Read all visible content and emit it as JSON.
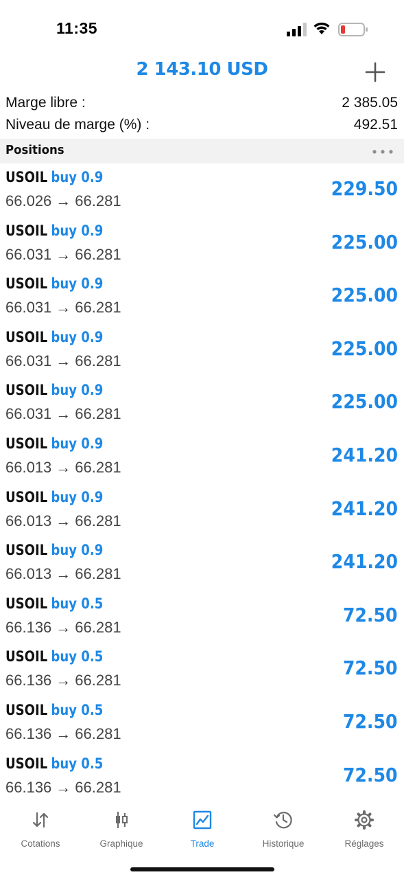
{
  "status_bar": {
    "time": "11:35",
    "battery_color": "#e53935"
  },
  "header": {
    "balance": "2 143.10 USD",
    "add_icon": "plus-icon"
  },
  "summary": {
    "free_margin_label": "Marge libre :",
    "free_margin_value": "2 385.05",
    "margin_level_label": "Niveau de marge (%) :",
    "margin_level_value": "492.51"
  },
  "positions": {
    "title": "Positions",
    "more_icon": "more-horizontal-icon",
    "items": [
      {
        "symbol": "USOIL",
        "side": "buy 0.9",
        "open": "66.026",
        "arrow": "→",
        "current": "66.281",
        "profit": "229.50"
      },
      {
        "symbol": "USOIL",
        "side": "buy 0.9",
        "open": "66.031",
        "arrow": "→",
        "current": "66.281",
        "profit": "225.00"
      },
      {
        "symbol": "USOIL",
        "side": "buy 0.9",
        "open": "66.031",
        "arrow": "→",
        "current": "66.281",
        "profit": "225.00"
      },
      {
        "symbol": "USOIL",
        "side": "buy 0.9",
        "open": "66.031",
        "arrow": "→",
        "current": "66.281",
        "profit": "225.00"
      },
      {
        "symbol": "USOIL",
        "side": "buy 0.9",
        "open": "66.031",
        "arrow": "→",
        "current": "66.281",
        "profit": "225.00"
      },
      {
        "symbol": "USOIL",
        "side": "buy 0.9",
        "open": "66.013",
        "arrow": "→",
        "current": "66.281",
        "profit": "241.20"
      },
      {
        "symbol": "USOIL",
        "side": "buy 0.9",
        "open": "66.013",
        "arrow": "→",
        "current": "66.281",
        "profit": "241.20"
      },
      {
        "symbol": "USOIL",
        "side": "buy 0.9",
        "open": "66.013",
        "arrow": "→",
        "current": "66.281",
        "profit": "241.20"
      },
      {
        "symbol": "USOIL",
        "side": "buy 0.5",
        "open": "66.136",
        "arrow": "→",
        "current": "66.281",
        "profit": "72.50"
      },
      {
        "symbol": "USOIL",
        "side": "buy 0.5",
        "open": "66.136",
        "arrow": "→",
        "current": "66.281",
        "profit": "72.50"
      },
      {
        "symbol": "USOIL",
        "side": "buy 0.5",
        "open": "66.136",
        "arrow": "→",
        "current": "66.281",
        "profit": "72.50"
      },
      {
        "symbol": "USOIL",
        "side": "buy 0.5",
        "open": "66.136",
        "arrow": "→",
        "current": "66.281",
        "profit": "72.50"
      }
    ]
  },
  "tabs": [
    {
      "label": "Cotations",
      "icon": "quotes-arrows-icon",
      "active": false
    },
    {
      "label": "Graphique",
      "icon": "candlestick-chart-icon",
      "active": false
    },
    {
      "label": "Trade",
      "icon": "trade-chart-icon",
      "active": true
    },
    {
      "label": "Historique",
      "icon": "history-clock-icon",
      "active": false
    },
    {
      "label": "Réglages",
      "icon": "gear-icon",
      "active": false
    }
  ],
  "colors": {
    "accent": "#1e88e5",
    "section_bg": "#f2f2f2",
    "inactive_tab": "#6b6b6b"
  }
}
